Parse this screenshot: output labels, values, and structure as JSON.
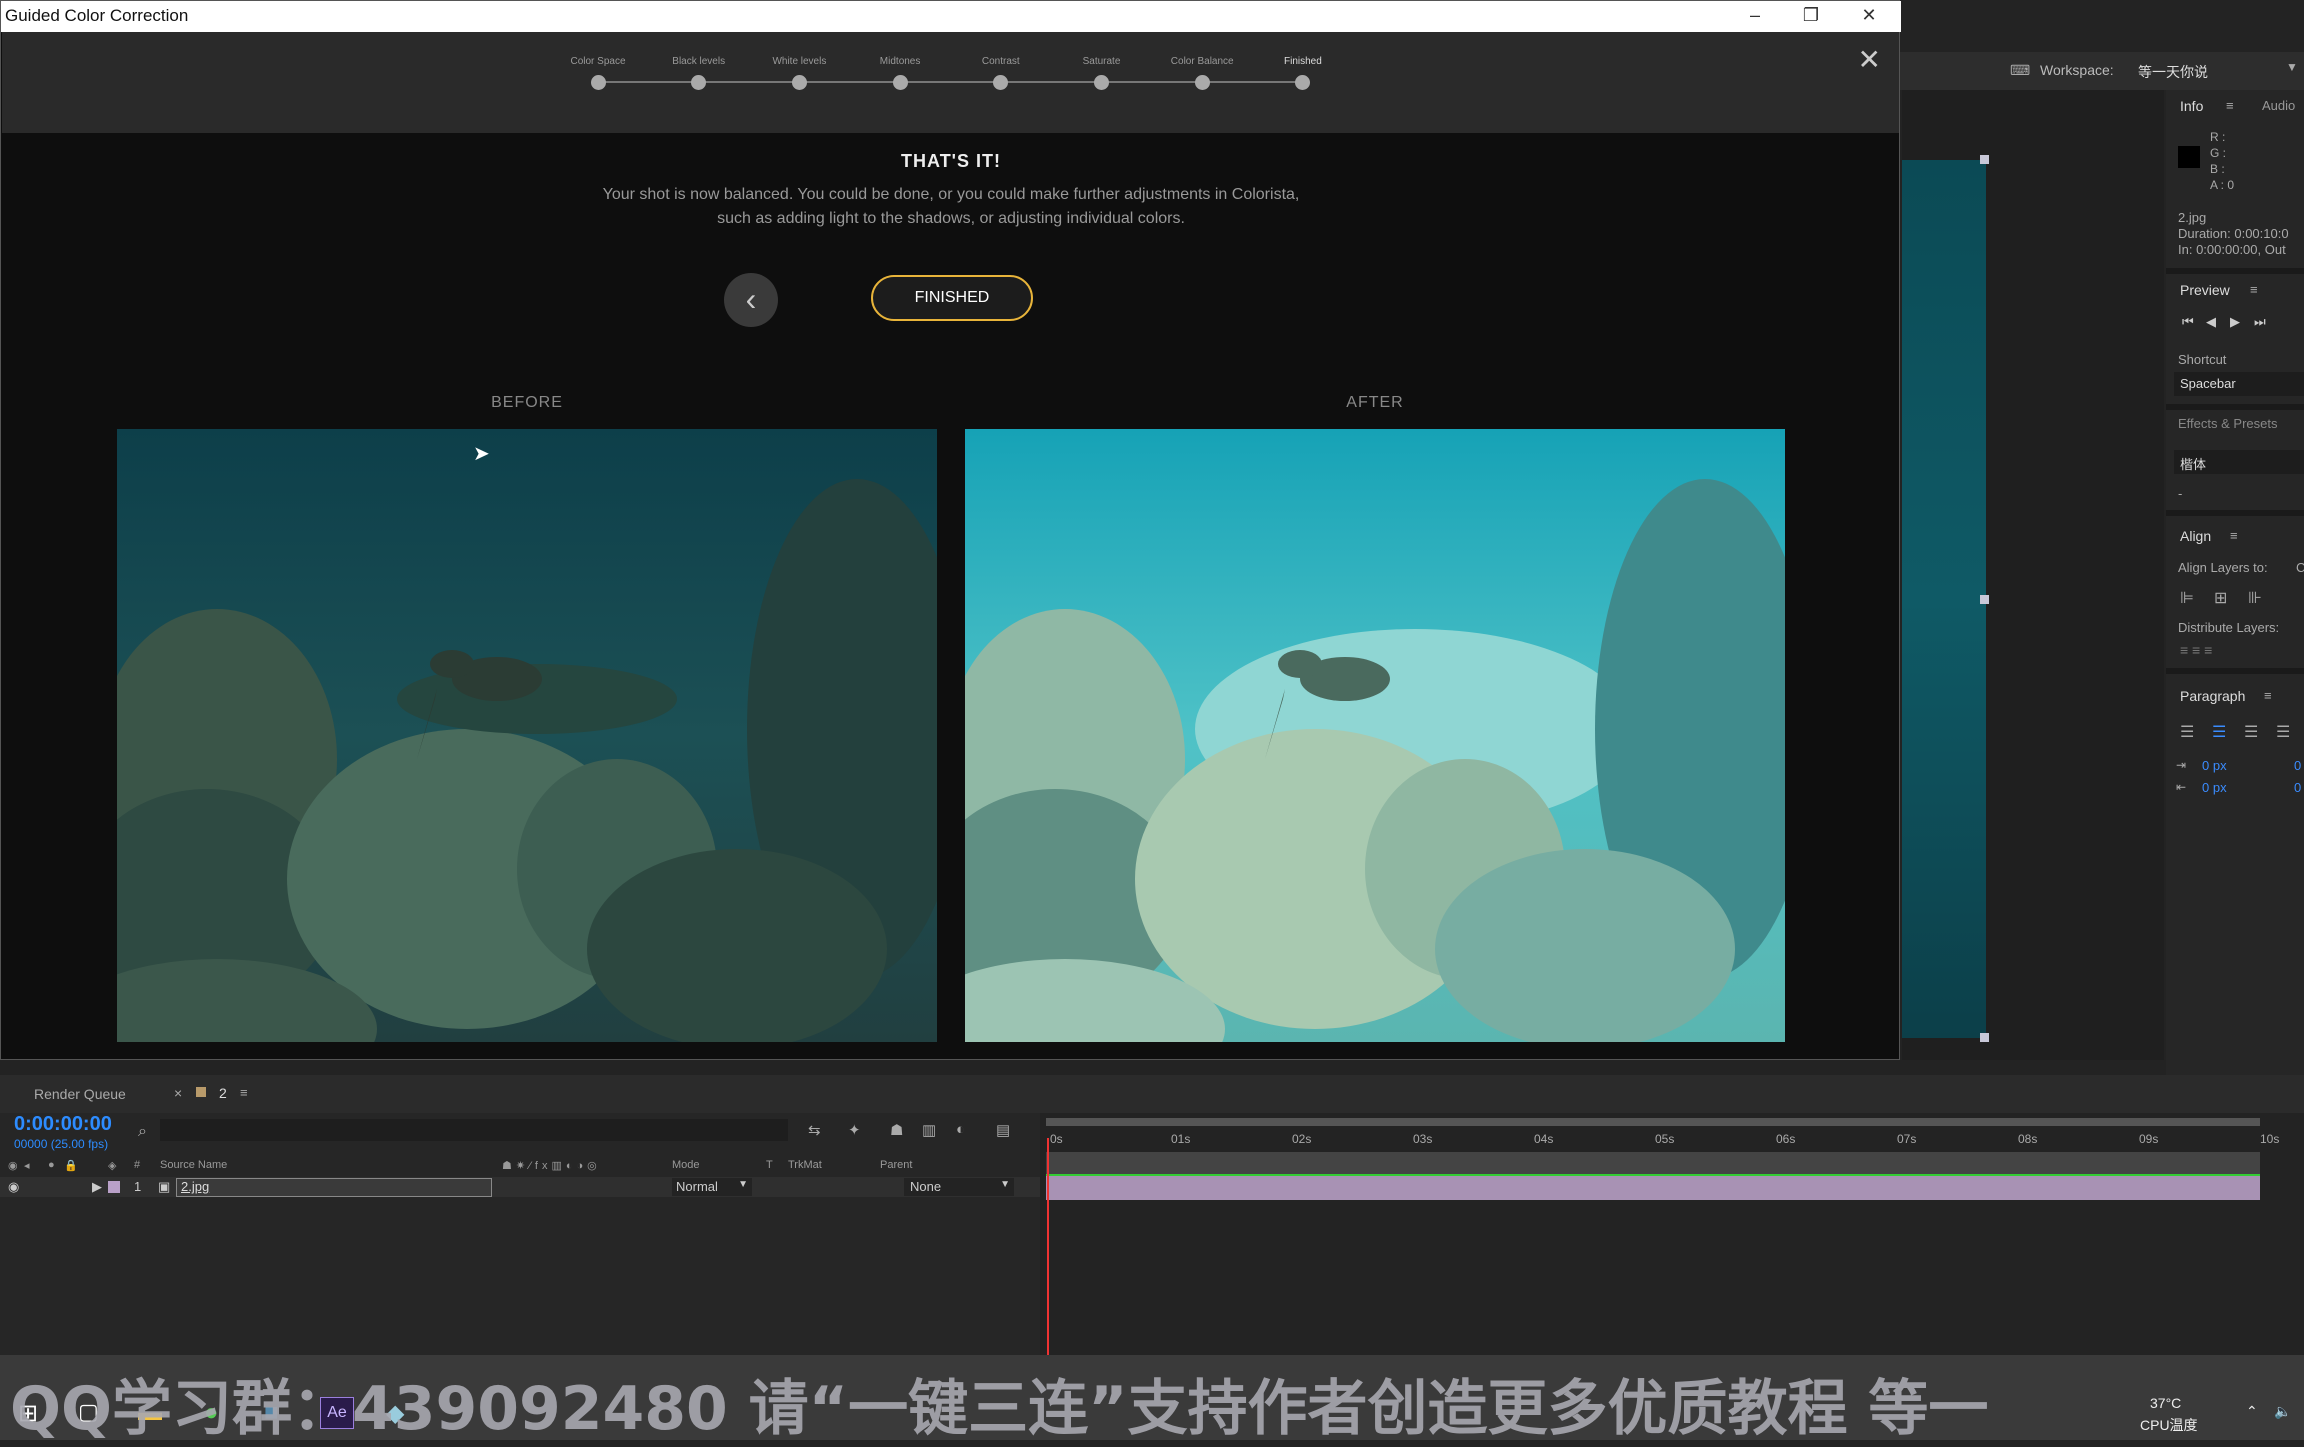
{
  "dialog": {
    "title": "Guided Color Correction",
    "steps": [
      "Color Space",
      "Black levels",
      "White levels",
      "Midtones",
      "Contrast",
      "Saturate",
      "Color Balance",
      "Finished"
    ],
    "heading": "THAT'S IT!",
    "description": "Your shot is now balanced. You could be done, or you could make further adjustments in Colorista, such as adding light to the shadows, or adjusting individual colors.",
    "finished_button": "FINISHED",
    "before_label": "BEFORE",
    "after_label": "AFTER"
  },
  "workspace": {
    "label": "Workspace:",
    "value": "等一天你说"
  },
  "info_panel": {
    "tab": "Info",
    "tab2": "Audio",
    "r": "R :",
    "g": "G :",
    "b": "B :",
    "a": "A : 0",
    "file": "2.jpg",
    "duration": "Duration: 0:00:10:0",
    "in_out": "In: 0:00:00:00, Out"
  },
  "preview_panel": {
    "title": "Preview",
    "shortcut_label": "Shortcut",
    "shortcut_value": "Spacebar"
  },
  "effects_panel": {
    "title": "Effects & Presets",
    "search_value": "楷体",
    "item": "-"
  },
  "align_panel": {
    "title": "Align",
    "align_to": "Align Layers to:",
    "align_to_value": "C",
    "distribute": "Distribute Layers:"
  },
  "paragraph_panel": {
    "title": "Paragraph",
    "indent1": "0 px",
    "indent2": "0 px",
    "right1": "0",
    "right2": "0"
  },
  "timeline": {
    "tab_render": "Render Queue",
    "tab_comp": "2",
    "timecode": "0:00:00:00",
    "fps": "00000 (25.00 fps)",
    "col_source": "Source Name",
    "col_num": "#",
    "col_mode": "Mode",
    "col_t": "T",
    "col_trkmat": "TrkMat",
    "col_parent": "Parent",
    "layer_num": "1",
    "layer_name": "2.jpg",
    "layer_mode": "Normal",
    "layer_parent": "None",
    "ruler": [
      "0s",
      "01s",
      "02s",
      "03s",
      "04s",
      "05s",
      "06s",
      "07s",
      "08s",
      "09s",
      "10s"
    ]
  },
  "taskbar": {
    "watermark": "QQ学习群：439092480    请“一键三连”支持作者创造更多优质教程    等一",
    "temp": "37°C",
    "cpu": "CPU温度"
  }
}
